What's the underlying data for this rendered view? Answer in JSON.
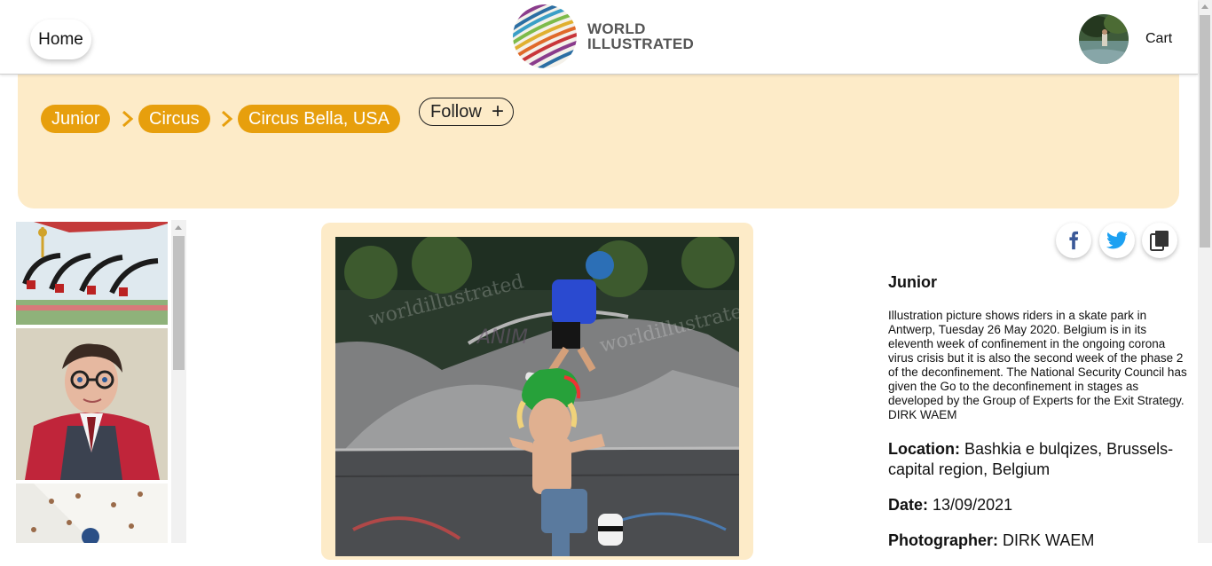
{
  "header": {
    "home_label": "Home",
    "logo_line1": "WORLD",
    "logo_line2": "ILLUSTRATED",
    "cart_label": "Cart"
  },
  "breadcrumb": {
    "items": [
      "Junior",
      "Circus",
      "Circus Bella, USA"
    ],
    "follow_label": "Follow"
  },
  "photo": {
    "watermark": "worldillustrated"
  },
  "share": {
    "icons": [
      "facebook-icon",
      "twitter-icon",
      "copy-icon"
    ]
  },
  "info": {
    "title": "Junior",
    "description": "Illustration picture shows riders in a skate park in Antwerp, Tuesday 26 May 2020. Belgium is in its eleventh week of confinement in the ongoing corona virus crisis but it is also the second week of the phase 2 of the deconfinement. The National Security Council has given the Go to the deconfinement in stages as developed by the Group of Experts for the Exit Strategy. DIRK WAEM",
    "location_label": "Location:",
    "location_value": "Bashkia e bulqizes, Brussels-capital region, Belgium",
    "date_label": "Date:",
    "date_value": "13/09/2021",
    "photographer_label": "Photographer:",
    "photographer_value": "DIRK WAEM"
  },
  "colors": {
    "accent": "#e79f0d",
    "banner": "#fdebc8"
  }
}
